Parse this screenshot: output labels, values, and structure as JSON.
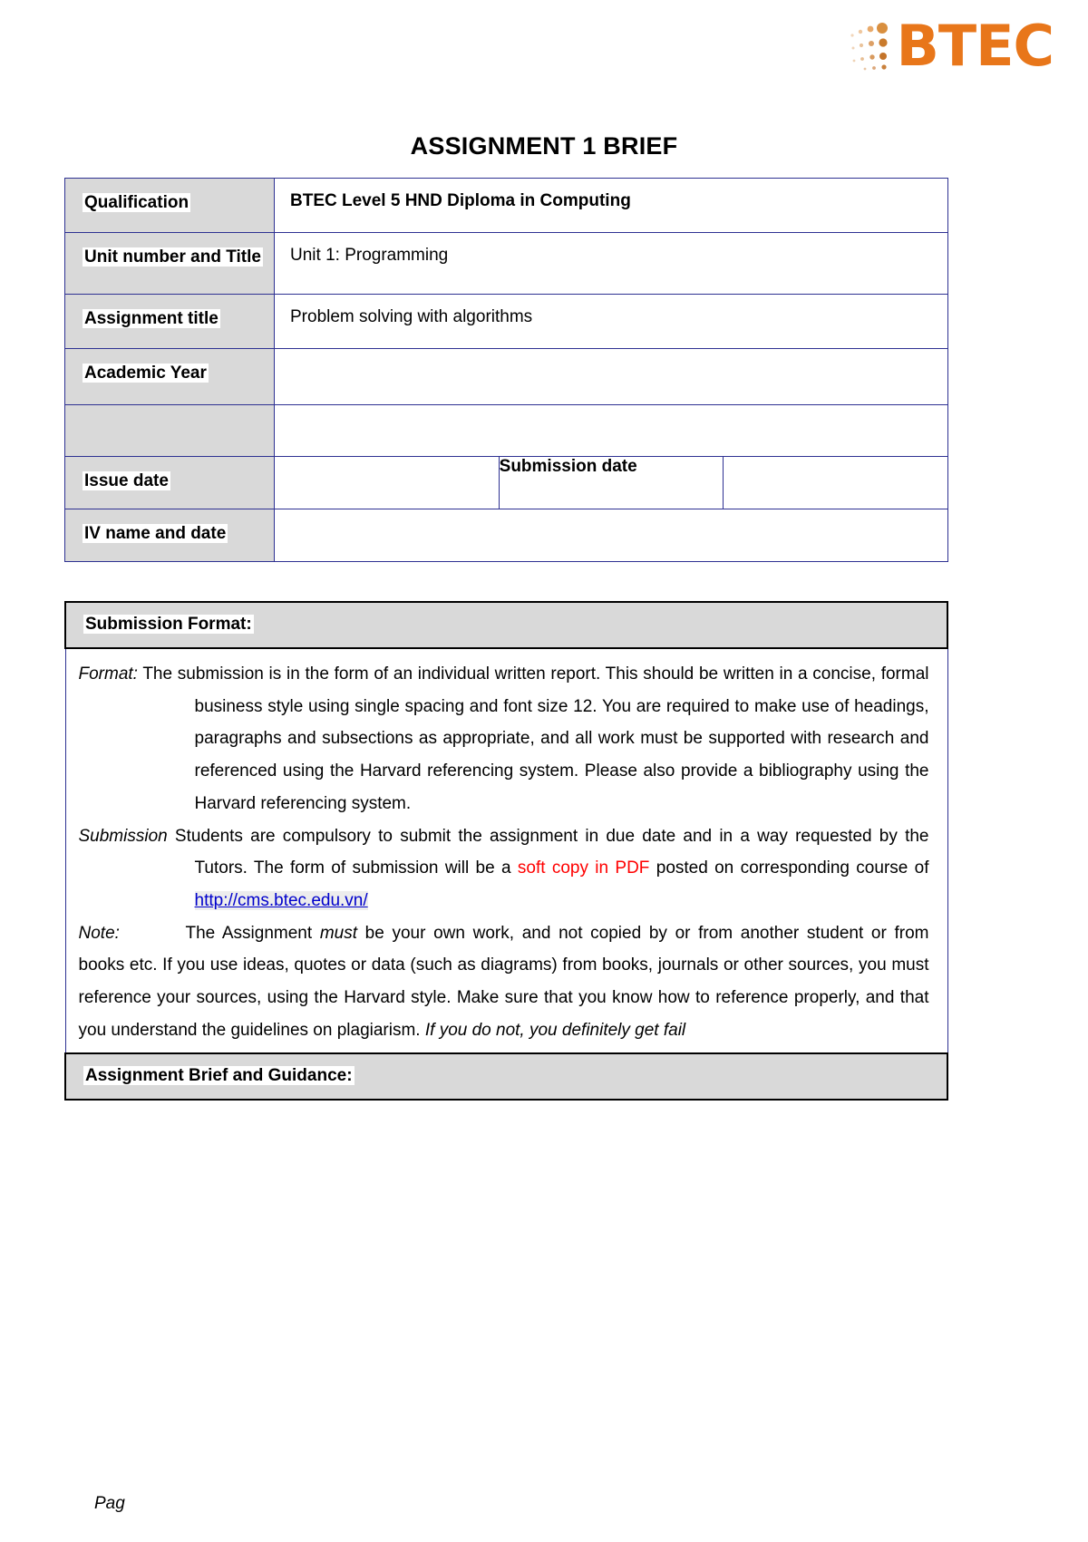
{
  "logo": {
    "text": "BTEC",
    "color": "#E8761A",
    "dots_icon": "btec-dot-pattern-icon"
  },
  "document": {
    "title": "ASSIGNMENT 1 BRIEF",
    "footer_text": "Pag"
  },
  "info_table": {
    "border_color": "#2E3192",
    "label_bg": "#D9D9D9",
    "rows": [
      {
        "label": "Qualification",
        "value": "BTEC Level 5 HND Diploma in Computing",
        "value_bold": true
      },
      {
        "label": "Unit number and Title",
        "value": "Unit 1: Programming",
        "value_bold": false
      },
      {
        "label": "Assignment title",
        "value": "Problem solving with algorithms",
        "value_bold": false
      },
      {
        "label": "Academic Year",
        "value": "",
        "value_bold": false
      },
      {
        "label": "",
        "value": "",
        "value_bold": false
      },
      {
        "label": "Issue date",
        "value": "",
        "second_label": "Submission date",
        "second_value": ""
      },
      {
        "label": "IV name and date",
        "value": "",
        "value_bold": false
      }
    ]
  },
  "format_table": {
    "header": "Submission Format:",
    "guidance_header": "Assignment Brief and Guidance:",
    "format_paragraph": {
      "lead": "Format:",
      "text": " The submission is in the form of an individual written report. This should be written in a concise, formal business style using single spacing and font size 12. You are required to make use of headings, paragraphs and subsections as appropriate, and all work must be supported with research and referenced using the Harvard referencing system. Please also provide a bibliography using the Harvard referencing system."
    },
    "submission_paragraph": {
      "lead": "Submission",
      "text_1": " Students are compulsory to submit the assignment in due date and in a way requested by the Tutors. The form of submission will be a ",
      "highlight_red": "soft copy in PDF",
      "text_2": " posted on corresponding course of ",
      "link_text": "http://cms.btec.edu.vn/",
      "red_color": "#FF0000",
      "link_color": "#0000CC"
    },
    "note_paragraph": {
      "lead": "Note:",
      "text_1": "The Assignment ",
      "emphasis_1": "must",
      "text_2": " be your own work, and not copied by or from another student or from books etc. If you use ideas, quotes or data (such as diagrams) from books, journals or other sources, you must reference your sources, using the Harvard style. Make sure that you know how to reference properly, and that you understand the guidelines on plagiarism. ",
      "emphasis_2": "If you do not, you definitely get fail"
    }
  }
}
